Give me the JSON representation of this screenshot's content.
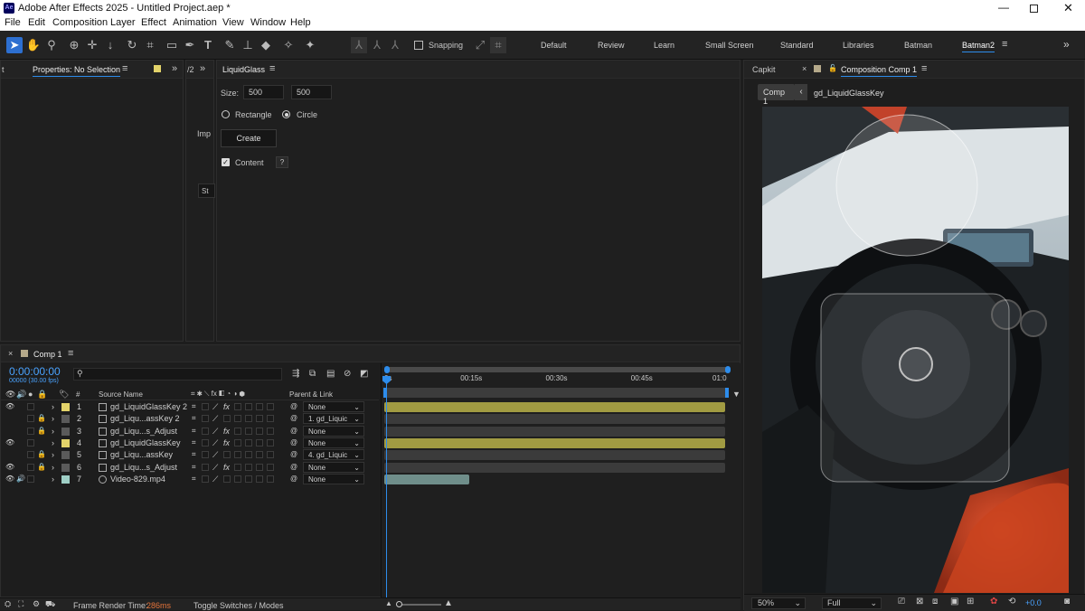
{
  "window": {
    "title": "Adobe After Effects 2025 - Untitled Project.aep *",
    "app_badge": "Ae"
  },
  "menu": [
    "File",
    "Edit",
    "Composition",
    "Layer",
    "Effect",
    "Animation",
    "View",
    "Window",
    "Help"
  ],
  "toolbar": {
    "snapping_label": "Snapping",
    "workspaces": [
      "Default",
      "Review",
      "Learn",
      "Small Screen",
      "Standard",
      "Libraries",
      "Batman",
      "Batman2"
    ],
    "active_workspace": "Batman2",
    "more_icon": "double-chevron-right-icon"
  },
  "properties_panel": {
    "tab": "Properties: No Selection"
  },
  "narrow_panel": {
    "tab": "/2",
    "import_label": "Imp",
    "field_text": "St"
  },
  "liquidglass": {
    "tab": "LiquidGlass",
    "size_label": "Size:",
    "size_w": "500",
    "size_h": "500",
    "shape_rect": "Rectangle",
    "shape_circle": "Circle",
    "selected_shape": "Circle",
    "create_label": "Create",
    "content_label": "Content",
    "content_checked": true,
    "help_label": "?"
  },
  "comp_viewer": {
    "tab_left": "Capkit",
    "tab_active": "Composition Comp 1",
    "crumb_comp": "Comp 1",
    "crumb_layer": "gd_LiquidGlassKey",
    "zoom": "50%",
    "resolution": "Full",
    "exposure": "+0.0"
  },
  "timeline": {
    "tab": "Comp 1",
    "timecode": "0:00:00:00",
    "fps_label": "00000 (30.00 fps)",
    "col_source": "Source Name",
    "col_hash": "#",
    "col_parent": "Parent & Link",
    "ruler": [
      "0s",
      "00:15s",
      "00:30s",
      "00:45s",
      "01:0"
    ],
    "layers": [
      {
        "num": "1",
        "name": "gd_LiquidGlassKey 2",
        "parent": "None",
        "label_color": "#e3d36a",
        "visible": true,
        "locked": false,
        "fx": true,
        "bar_color": "#a19b42",
        "bar_end": 1.0
      },
      {
        "num": "2",
        "name": "gd_Liqu...assKey 2",
        "parent": "1. gd_Liquic",
        "label_color": "#5a5a5a",
        "visible": false,
        "locked": true,
        "fx": false,
        "bar_color": "#3b3b3b",
        "bar_end": 1.0
      },
      {
        "num": "3",
        "name": "gd_Liqu...s_Adjust",
        "parent": "None",
        "label_color": "#5a5a5a",
        "visible": false,
        "locked": true,
        "fx": true,
        "bar_color": "#3b3b3b",
        "bar_end": 1.0
      },
      {
        "num": "4",
        "name": "gd_LiquidGlassKey",
        "parent": "None",
        "label_color": "#e3d36a",
        "visible": true,
        "locked": false,
        "fx": true,
        "bar_color": "#a19b42",
        "bar_end": 1.0
      },
      {
        "num": "5",
        "name": "gd_Liqu...assKey",
        "parent": "4. gd_Liquic",
        "label_color": "#5a5a5a",
        "visible": false,
        "locked": true,
        "fx": false,
        "bar_color": "#3b3b3b",
        "bar_end": 1.0
      },
      {
        "num": "6",
        "name": "gd_Liqu...s_Adjust",
        "parent": "None",
        "label_color": "#5a5a5a",
        "visible": true,
        "locked": true,
        "fx": true,
        "bar_color": "#3b3b3b",
        "bar_end": 1.0
      },
      {
        "num": "7",
        "name": "Video-829.mp4",
        "parent": "None",
        "label_color": "#9fcfc6",
        "visible": true,
        "locked": false,
        "fx": false,
        "bar_color": "#6f8e8a",
        "bar_end": 0.25
      }
    ]
  },
  "statusbar": {
    "render_label": "Frame Render Time:",
    "render_value": "286ms",
    "toggle_label": "Toggle Switches / Modes"
  },
  "colors": {
    "accent": "#2d8ceb",
    "timecode": "#4aa3ff",
    "render_value": "#e3733a",
    "label_yellow": "#e3d36a"
  }
}
